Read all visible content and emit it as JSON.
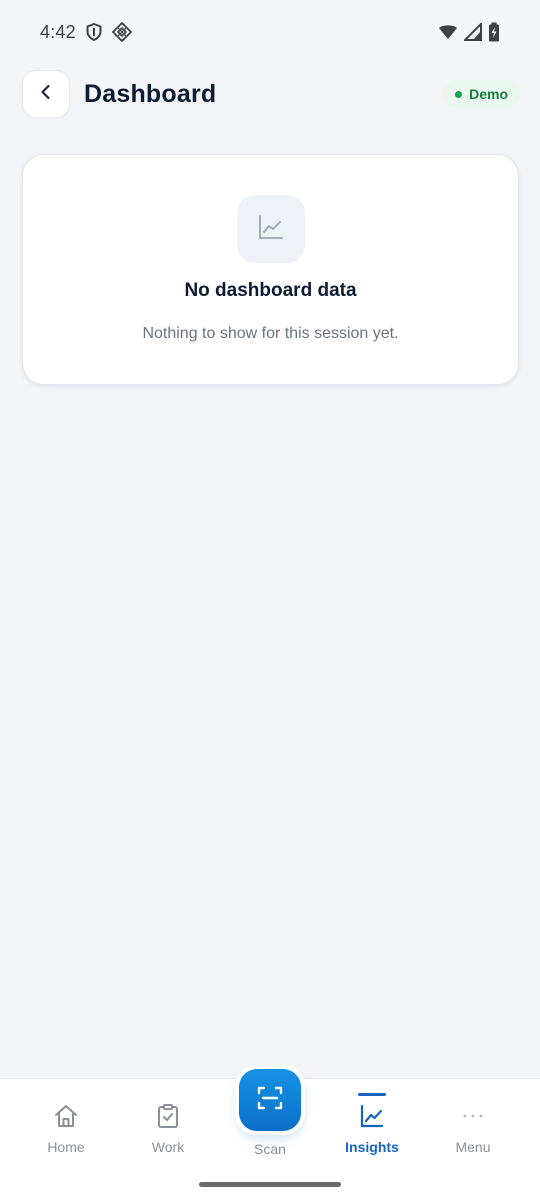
{
  "status_bar": {
    "time": "4:42",
    "left_icons": [
      "shield-icon",
      "diamond-grid-icon"
    ],
    "right_icons": [
      "wifi-icon",
      "signal-icon",
      "battery-charging-icon"
    ]
  },
  "header": {
    "back_icon": "chevron-left-icon",
    "title": "Dashboard",
    "badge": {
      "label": "Demo",
      "color": "#16a34a"
    }
  },
  "empty_state": {
    "icon": "line-chart-icon",
    "title": "No dashboard data",
    "subtitle": "Nothing to show for this session yet."
  },
  "bottom_nav": {
    "items": [
      {
        "label": "Home",
        "icon": "home-icon",
        "active": false
      },
      {
        "label": "Work",
        "icon": "clipboard-check-icon",
        "active": false
      },
      {
        "label": "Scan",
        "icon": "scan-icon",
        "active": false
      },
      {
        "label": "Insights",
        "icon": "line-chart-icon",
        "active": true
      },
      {
        "label": "Menu",
        "icon": "more-horizontal-icon",
        "active": false
      }
    ],
    "accent_color": "#1565c0"
  }
}
